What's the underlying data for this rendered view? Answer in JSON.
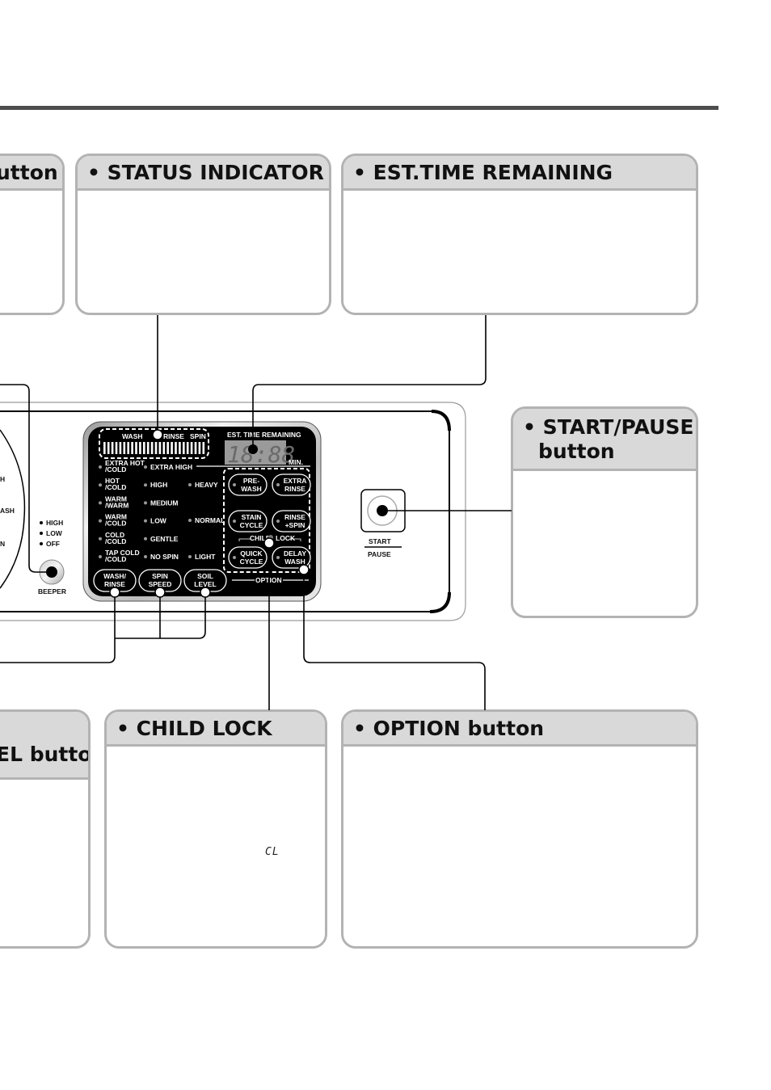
{
  "callouts": {
    "left_top": {
      "title": "utton"
    },
    "status_indicator": {
      "title": "• STATUS INDICATOR"
    },
    "est_time": {
      "title": "• EST.TIME REMAINING"
    },
    "start_pause": {
      "title_line1": "• START/PAUSE",
      "title_line2": "button"
    },
    "left_bottom": {
      "title": "EL button"
    },
    "child_lock": {
      "title": "• CHILD LOCK",
      "display_code": "CL"
    },
    "option": {
      "title": "• OPTION button"
    }
  },
  "panel": {
    "status_bar": {
      "wash": "WASH",
      "rinse": "RINSE",
      "spin": "SPIN"
    },
    "est_time_label": "EST. TIME REMAINING",
    "time_display": "18:88",
    "min_label": "MIN.",
    "temps": [
      "EXTRA HOT",
      "/COLD",
      "HOT",
      "/COLD",
      "WARM",
      "/WARM",
      "WARM",
      "/COLD",
      "COLD",
      "/COLD",
      "TAP COLD",
      "/COLD"
    ],
    "spin_speeds": [
      "EXTRA HIGH",
      "HIGH",
      "MEDIUM",
      "LOW",
      "GENTLE",
      "NO SPIN"
    ],
    "soil_levels": [
      "HEAVY",
      "NORMAL",
      "LIGHT"
    ],
    "buttons": {
      "wash_rinse": [
        "WASH/",
        "RINSE"
      ],
      "spin_speed": [
        "SPIN",
        "SPEED"
      ],
      "soil_level": [
        "SOIL",
        "LEVEL"
      ]
    },
    "options": {
      "pre_wash": [
        "PRE-",
        "WASH"
      ],
      "extra_rinse": [
        "EXTRA",
        "RINSE"
      ],
      "stain_cycle": [
        "STAIN",
        "CYCLE"
      ],
      "rinse_spin": [
        "RINSE",
        "+SPIN"
      ],
      "quick_cycle": [
        "QUICK",
        "CYCLE"
      ],
      "delay_wash": [
        "DELAY",
        "WASH"
      ]
    },
    "child_label": "CHILD",
    "lock_label": "LOCK",
    "option_label": "OPTION",
    "beeper": {
      "levels": [
        "HIGH",
        "LOW",
        "OFF"
      ],
      "label": "BEEPER"
    },
    "dial_fragments": [
      "H",
      "ASH",
      "N"
    ],
    "start_label": "START",
    "pause_label": "PAUSE"
  }
}
